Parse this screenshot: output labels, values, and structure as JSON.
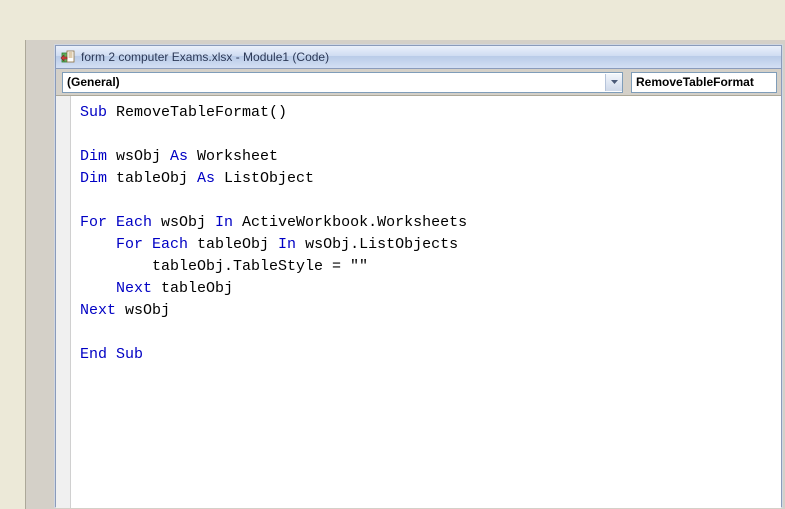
{
  "titlebar": {
    "title": "form 2 computer Exams.xlsx - Module1 (Code)"
  },
  "selectors": {
    "object_label": "(General)",
    "procedure_label": "RemoveTableFormat"
  },
  "code": {
    "lines": [
      {
        "tokens": [
          {
            "t": "kw",
            "s": "Sub"
          },
          {
            "t": "",
            "s": " RemoveTableFormat()"
          }
        ]
      },
      {
        "tokens": []
      },
      {
        "tokens": [
          {
            "t": "kw",
            "s": "Dim"
          },
          {
            "t": "",
            "s": " wsObj "
          },
          {
            "t": "kw",
            "s": "As"
          },
          {
            "t": "",
            "s": " Worksheet"
          }
        ]
      },
      {
        "tokens": [
          {
            "t": "kw",
            "s": "Dim"
          },
          {
            "t": "",
            "s": " tableObj "
          },
          {
            "t": "kw",
            "s": "As"
          },
          {
            "t": "",
            "s": " ListObject"
          }
        ]
      },
      {
        "tokens": []
      },
      {
        "tokens": [
          {
            "t": "kw",
            "s": "For Each"
          },
          {
            "t": "",
            "s": " wsObj "
          },
          {
            "t": "kw",
            "s": "In"
          },
          {
            "t": "",
            "s": " ActiveWorkbook.Worksheets"
          }
        ]
      },
      {
        "tokens": [
          {
            "t": "",
            "s": "    "
          },
          {
            "t": "kw",
            "s": "For Each"
          },
          {
            "t": "",
            "s": " tableObj "
          },
          {
            "t": "kw",
            "s": "In"
          },
          {
            "t": "",
            "s": " wsObj.ListObjects"
          }
        ]
      },
      {
        "tokens": [
          {
            "t": "",
            "s": "        tableObj.TableStyle = \"\""
          }
        ]
      },
      {
        "tokens": [
          {
            "t": "",
            "s": "    "
          },
          {
            "t": "kw",
            "s": "Next"
          },
          {
            "t": "",
            "s": " tableObj"
          }
        ]
      },
      {
        "tokens": [
          {
            "t": "kw",
            "s": "Next"
          },
          {
            "t": "",
            "s": " wsObj"
          }
        ]
      },
      {
        "tokens": []
      },
      {
        "tokens": [
          {
            "t": "kw",
            "s": "End Sub"
          }
        ]
      }
    ]
  }
}
